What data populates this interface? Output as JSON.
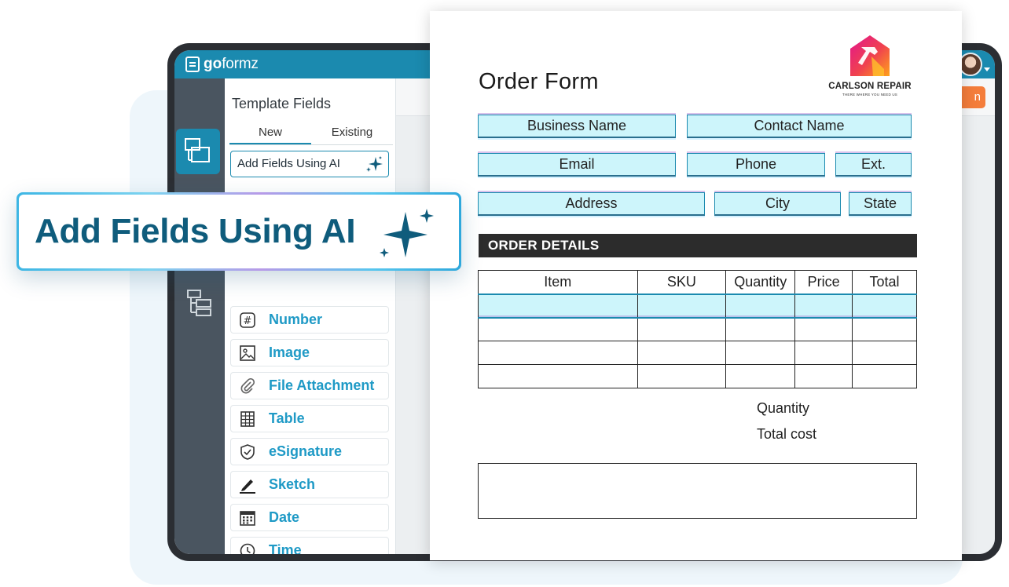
{
  "app": {
    "logo_bold": "go",
    "logo_light": "formz",
    "header_button_label": "n"
  },
  "sidebar": {
    "rail_icons": [
      "template-icon",
      "form-icon",
      "workflow-icon"
    ]
  },
  "template_fields": {
    "title": "Template Fields",
    "tabs": [
      {
        "label": "New",
        "active": true
      },
      {
        "label": "Existing",
        "active": false
      }
    ],
    "ai_button_label": "Add Fields Using AI",
    "fields": [
      {
        "label": "Number",
        "icon": "hash-icon"
      },
      {
        "label": "Image",
        "icon": "image-icon"
      },
      {
        "label": "File Attachment",
        "icon": "paperclip-icon"
      },
      {
        "label": "Table",
        "icon": "table-icon"
      },
      {
        "label": "eSignature",
        "icon": "shield-check-icon"
      },
      {
        "label": "Sketch",
        "icon": "pen-icon"
      },
      {
        "label": "Date",
        "icon": "calendar-icon"
      },
      {
        "label": "Time",
        "icon": "clock-icon"
      }
    ]
  },
  "callout": {
    "label": "Add Fields Using AI"
  },
  "order_form": {
    "title": "Order Form",
    "brand_name": "CARLSON REPAIR",
    "brand_tagline": "THERE WHERE YOU NEED US",
    "fields": {
      "business_name": "Business Name",
      "contact_name": "Contact Name",
      "email": "Email",
      "phone": "Phone",
      "ext": "Ext.",
      "address": "Address",
      "city": "City",
      "state": "State"
    },
    "section_title": "ORDER DETAILS",
    "table": {
      "columns": [
        "Item",
        "SKU",
        "Quantity",
        "Price",
        "Total"
      ],
      "rows": [
        [
          "",
          "",
          "",
          "",
          ""
        ],
        [
          "",
          "",
          "",
          "",
          ""
        ],
        [
          "",
          "",
          "",
          "",
          ""
        ],
        [
          "",
          "",
          "",
          "",
          ""
        ]
      ]
    },
    "summary": {
      "quantity_label": "Quantity",
      "total_cost_label": "Total cost"
    }
  },
  "colors": {
    "brand_teal": "#1b8aaf",
    "field_fill": "#cdf5fb",
    "label_blue": "#1f9ac6",
    "callout_text": "#0f5c7c",
    "accent_orange": "#f47d3b"
  }
}
